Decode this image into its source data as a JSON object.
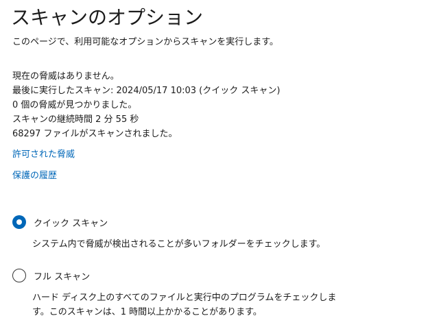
{
  "page": {
    "title": "スキャンのオプション",
    "subtitle": "このページで、利用可能なオプションからスキャンを実行します。"
  },
  "status": {
    "lines": [
      "現在の脅威はありません。",
      "最後に実行したスキャン: 2024/05/17 10:03 (クイック スキャン)",
      "0 個の脅威が見つかりました。",
      "スキャンの継続時間 2 分 55 秒",
      "68297 ファイルがスキャンされました。"
    ]
  },
  "links": {
    "allowed_threats": "許可された脅威",
    "protection_history": "保護の履歴"
  },
  "options": {
    "selected": "quick",
    "quick": {
      "label": "クイック スキャン",
      "description": "システム内で脅威が検出されることが多いフォルダーをチェックします。"
    },
    "full": {
      "label": "フル スキャン",
      "description": "ハード ディスク上のすべてのファイルと実行中のプログラムをチェックします。このスキャンは、1 時間以上かかることがあります。"
    }
  },
  "colors": {
    "accent": "#0067b8",
    "text": "#1b1b1b",
    "background": "#ffffff"
  }
}
